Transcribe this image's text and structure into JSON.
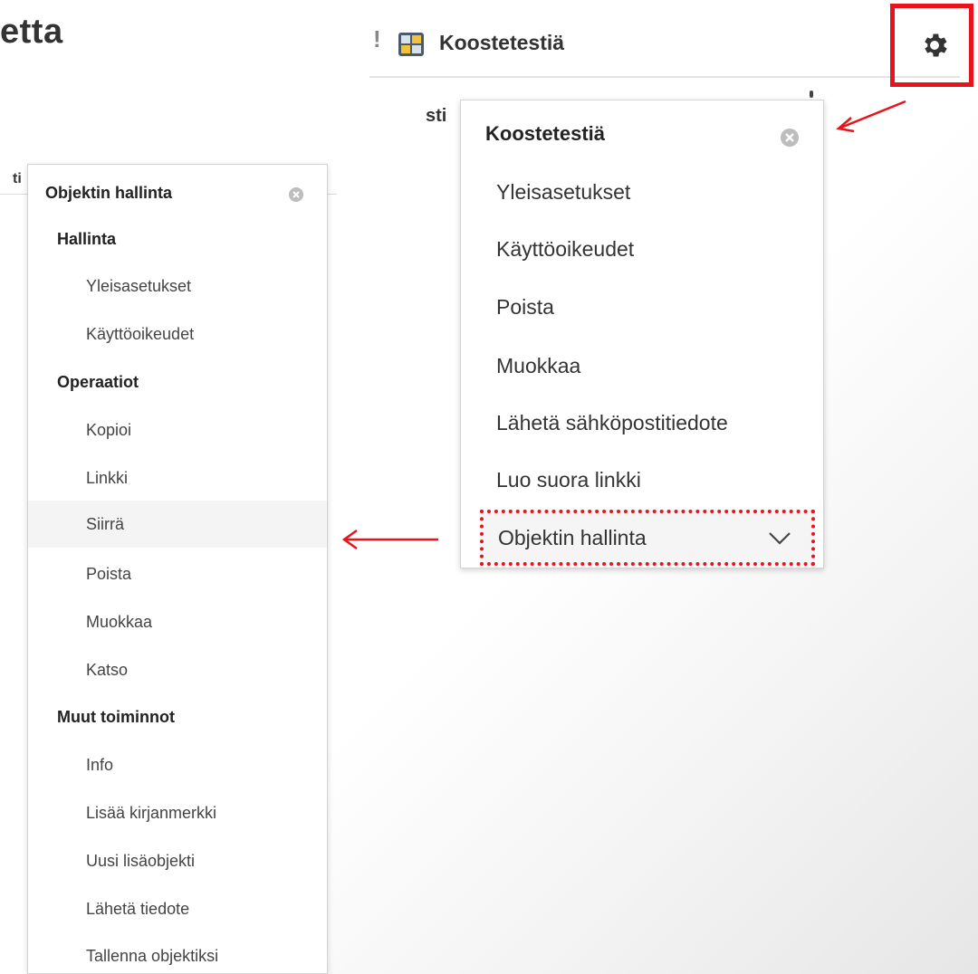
{
  "background": {
    "heading_fragment": "etta",
    "behind_right_menu_fragment": "sti",
    "behind_left_menu_fragment": "ti"
  },
  "header": {
    "alert_icon": "exclamation-icon",
    "app_icon": "report-grid-icon",
    "title": "Koostetestiä",
    "settings_icon": "gear-icon"
  },
  "annotations": {
    "highlight_color": "#e8141b",
    "arrow_color": "#e8141b"
  },
  "context_menu": {
    "title": "Koostetestiä",
    "close_icon": "close-circle-icon",
    "items": [
      "Yleisasetukset",
      "Käyttöoikeudet",
      "Poista",
      "Muokkaa",
      "Lähetä sähköpostitiedote",
      "Luo suora linkki"
    ],
    "submenu_item": "Objektin hallinta",
    "submenu_icon": "chevron-down-icon"
  },
  "submenu": {
    "title": "Objektin hallinta",
    "close_icon": "close-circle-icon",
    "sections": [
      {
        "heading": "Hallinta",
        "items": [
          "Yleisasetukset",
          "Käyttöoikeudet"
        ]
      },
      {
        "heading": "Operaatiot",
        "items": [
          "Kopioi",
          "Linkki",
          "Siirrä",
          "Poista",
          "Muokkaa",
          "Katso"
        ]
      },
      {
        "heading": "Muut toiminnot",
        "items": [
          "Info",
          "Lisää kirjanmerkki",
          "Uusi lisäobjekti",
          "Lähetä tiedote",
          "Tallenna objektiksi"
        ]
      }
    ],
    "hovered_item": "Siirrä"
  }
}
